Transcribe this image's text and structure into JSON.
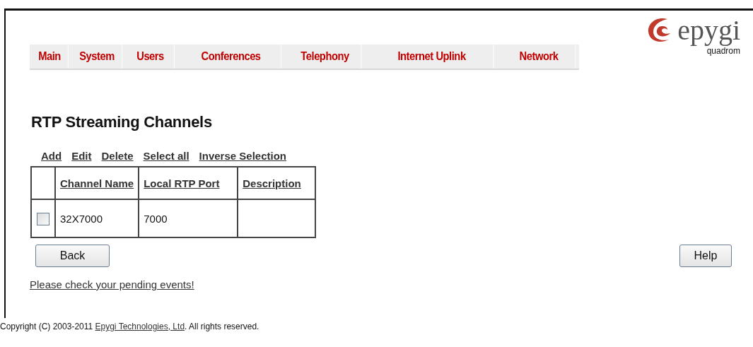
{
  "nav_tabs": [
    {
      "label": "Main"
    },
    {
      "label": "System"
    },
    {
      "label": "Users"
    },
    {
      "label": "Conferences"
    },
    {
      "label": "Telephony"
    },
    {
      "label": "Internet Uplink"
    },
    {
      "label": "Network"
    }
  ],
  "logo": {
    "brand": "epygi",
    "product": "quadrom"
  },
  "page_title": "RTP Streaming Channels",
  "actions": [
    "Add",
    "Edit",
    "Delete",
    "Select all",
    "Inverse Selection"
  ],
  "table": {
    "columns": [
      "Channel Name",
      "Local RTP Port",
      "Description"
    ],
    "rows": [
      {
        "checked": false,
        "cells": [
          "32X7000",
          "7000",
          ""
        ]
      }
    ]
  },
  "buttons": {
    "back": "Back",
    "help": "Help"
  },
  "pending_link": "Please check your pending events!",
  "footer": {
    "before": "Copyright (C) 2003-2011 ",
    "link": "Epygi Technologies, Ltd",
    "after": ". All rights reserved."
  }
}
